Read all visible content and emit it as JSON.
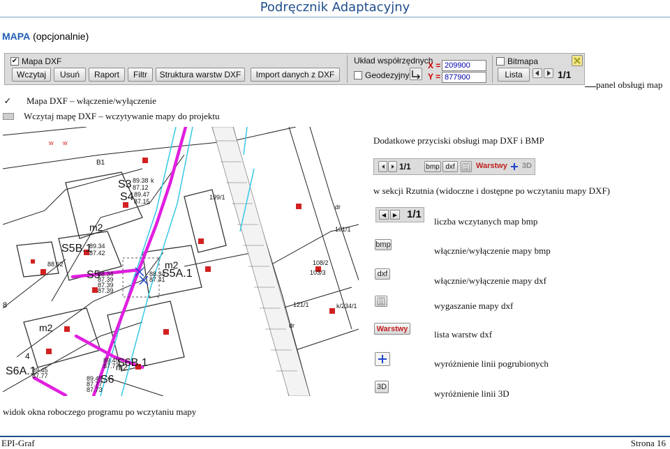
{
  "header": {
    "title": "Podręcznik Adaptacyjny"
  },
  "section": {
    "title_strong": "MAPA",
    "title_note": "(opcjonalnie)"
  },
  "panel": {
    "mapa_dxf_label": "Mapa DXF",
    "buttons": {
      "wczytaj": "Wczytaj",
      "usun": "Usuń",
      "raport": "Raport",
      "filtr": "Filtr",
      "struktura": "Struktura warstw DXF",
      "import": "Import danych z DXF",
      "lista": "Lista"
    },
    "uklad_label": "Układ współrzędnych",
    "geodezyjny_label": "Geodezyjny*",
    "x_label": "X =",
    "y_label": "Y =",
    "x_value": "209900",
    "y_value": "877900",
    "bitmapa_label": "Bitmapa",
    "pager": "1/1",
    "annotation": "panel obsługi map"
  },
  "bullets": [
    {
      "text": "Mapa DXF – włączenie/wyłączenie"
    },
    {
      "text": "Wczytaj mapę DXF – wczytywanie mapy do projektu"
    }
  ],
  "map": {
    "caption": "widok okna roboczego programu po wczytaniu mapy",
    "labels": {
      "s3": "S3",
      "s4": "S4",
      "s5b1": "S5B.1",
      "s5": "S5",
      "s5a1": "S5A.1",
      "s6a1": "S6A.1",
      "s6b1": "S6B.1",
      "s6": "S6",
      "m2a": "m2",
      "m2b": "m2",
      "m2c": "m2",
      "m2d": "m2",
      "b1": "B1",
      "p1991": "199/1",
      "dr1": "dr",
      "p1011": "101/1",
      "p1082": "108/2",
      "p1033": "103/3",
      "p1211": "121/1",
      "dr2": "dr",
      "p2341": "k/234/1",
      "v1": "89.38",
      "v2": "87.12",
      "v3": "89.47",
      "v4": "87.15",
      "v5": "89.34",
      "v6": "87.42",
      "v7": "88.34",
      "v8": "87.39",
      "v9": "87.39",
      "v10": "87.39",
      "v11": "88.34",
      "v12": "87.41",
      "v13": "89.45",
      "v14": "87.77",
      "v15": "89.45",
      "v16": "87.77",
      "v17": "89.45",
      "v18": "87.77",
      "v19": "87.73",
      "v20": "88.62",
      "eight": "8",
      "four": "4",
      "w1": "w",
      "w2": "w",
      "k1": "k"
    }
  },
  "right": {
    "dodatkowe": "Dodatkowe przyciski obsługi map DXF i BMP",
    "mini_toolbar": {
      "pager": "1/1",
      "bmp": "bmp",
      "dxf": "dxf",
      "warstwy": "Warstwy",
      "three_d": "3D"
    },
    "w_sekcji": "w sekcji Rzutnia (widoczne i dostępne po wczytaniu mapy DXF)",
    "pager_wide": "1/1",
    "items": [
      {
        "icon": "bmp",
        "text": "liczba wczytanych map bmp"
      },
      {
        "icon": "bmp",
        "text": "włącznie/wyłączenie mapy bmp"
      },
      {
        "icon": "dxf",
        "text": "włącznie/wyłączenie mapy dxf"
      },
      {
        "icon": "",
        "text": "wygaszanie mapy dxf"
      },
      {
        "icon": "Warstwy",
        "text": "lista warstw dxf"
      },
      {
        "icon": "",
        "text": "wyróżnienie linii pogrubionych"
      },
      {
        "icon": "3D",
        "text": "wyróżnienie linii 3D"
      }
    ]
  },
  "footer": {
    "left": "EPI-Graf",
    "right": "Strona 16"
  },
  "colors": {
    "header": "#1f4e8c",
    "section": "#1f5fb4",
    "magenta": "#e01fe0",
    "cyan": "#35c8e6",
    "red": "#d22020"
  }
}
